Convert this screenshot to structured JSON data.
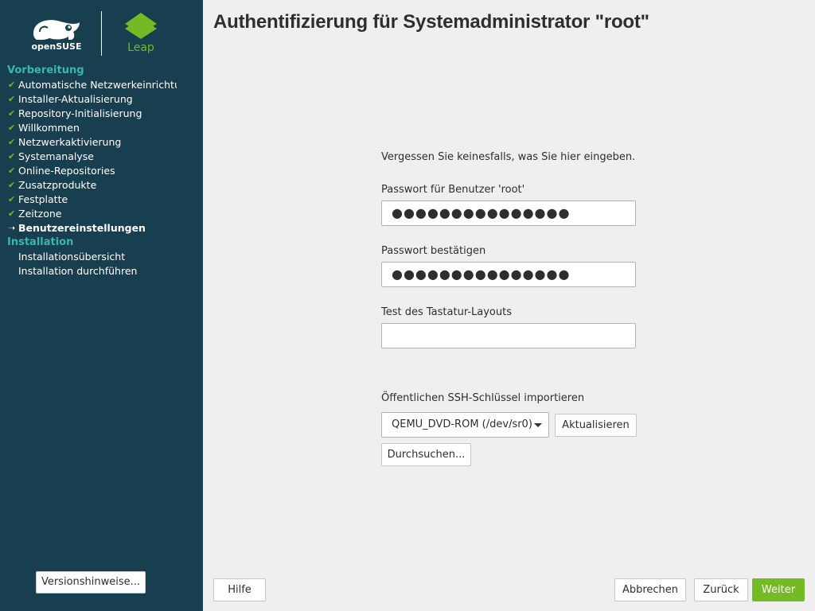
{
  "sidebar": {
    "logo_left_text": "openSUSE",
    "logo_right_text": "Leap",
    "sections": [
      {
        "title": "Vorbereitung",
        "items": [
          {
            "label": "Automatische Netzwerkeinrichtung",
            "state": "done"
          },
          {
            "label": "Installer-Aktualisierung",
            "state": "done"
          },
          {
            "label": "Repository-Initialisierung",
            "state": "done"
          },
          {
            "label": "Willkommen",
            "state": "done"
          },
          {
            "label": "Netzwerkaktivierung",
            "state": "done"
          },
          {
            "label": "Systemanalyse",
            "state": "done"
          },
          {
            "label": "Online-Repositories",
            "state": "done"
          },
          {
            "label": "Zusatzprodukte",
            "state": "done"
          },
          {
            "label": "Festplatte",
            "state": "done"
          },
          {
            "label": "Zeitzone",
            "state": "done"
          },
          {
            "label": "Benutzereinstellungen",
            "state": "current"
          }
        ]
      },
      {
        "title": "Installation",
        "items": [
          {
            "label": "Installationsübersicht",
            "state": "pending"
          },
          {
            "label": "Installation durchführen",
            "state": "pending"
          }
        ]
      }
    ],
    "release_notes_button": "Versionshinweise..."
  },
  "main": {
    "title": "Authentifizierung für Systemadministrator \"root\"",
    "hint": "Vergessen Sie keinesfalls, was Sie hier eingeben.",
    "password_label": "Passwort für Benutzer 'root'",
    "password_value": "●●●●●●●●●●●●●●●",
    "confirm_label": "Passwort bestätigen",
    "confirm_value": "●●●●●●●●●●●●●●●",
    "keyboard_test_label": "Test des Tastatur-Layouts",
    "keyboard_test_value": "",
    "ssh_label": "Öffentlichen SSH-Schlüssel importieren",
    "ssh_device": "QEMU_DVD-ROM (/dev/sr0)",
    "refresh_button": "Aktualisieren",
    "browse_button": "Durchsuchen..."
  },
  "footer": {
    "help": "Hilfe",
    "abort": "Abbrechen",
    "back": "Zurück",
    "next": "Weiter"
  },
  "colors": {
    "sidebar_bg": "#173f4f",
    "section_title": "#35b9ab",
    "check": "#73ba25",
    "primary_button": "#73ba25",
    "content_bg": "#efefef"
  },
  "icons": {
    "done": "checkmark-icon",
    "current": "arrow-right-icon",
    "combo": "chevron-down-icon"
  }
}
